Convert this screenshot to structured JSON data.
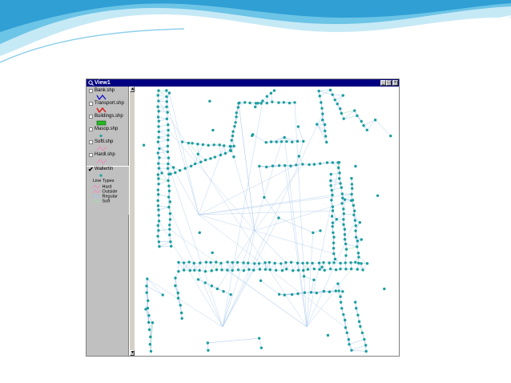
{
  "window": {
    "title": "View1",
    "minimize": "_",
    "maximize": "□",
    "close": "×"
  },
  "toc": {
    "layers": [
      {
        "name": "Bank.shp",
        "checked": false,
        "symbol": "blue-line-icon",
        "color": "#1a1acc"
      },
      {
        "name": "Transport.shp",
        "checked": false,
        "symbol": "red-line-icon",
        "color": "#dd1111"
      },
      {
        "name": "Buildings.shp",
        "checked": false,
        "symbol": "green-fill-icon",
        "color": "#22bb22"
      },
      {
        "name": "Masop.shp",
        "checked": false,
        "symbol": "teal-point-icon",
        "color": "#1aa3a3"
      },
      {
        "name": "Softl.shp",
        "checked": false,
        "symbol": "pink-line-icon",
        "color": "#ee88bb"
      },
      {
        "name": "Hardl.shp",
        "checked": false,
        "symbol": "pink-line-icon",
        "color": "#ee88bb"
      },
      {
        "name": "Wallertin",
        "checked": true,
        "symbol": "teal-point-icon",
        "color": "#1aa3a3"
      }
    ],
    "legend_title": "Line Types",
    "legend": [
      {
        "label": "Hard",
        "color": "#ee88bb"
      },
      {
        "label": "Outside",
        "color": "#ee88bb"
      },
      {
        "label": "Regular",
        "color": "#9ec8f0"
      },
      {
        "label": "Soft",
        "color": "#9ee0a8"
      }
    ]
  },
  "map": {
    "edge_color": "#a8c8ec",
    "soft_color": "#9ee0a8",
    "point_color": "#1a9e9e"
  },
  "theme": {
    "wave_dark": "#3aa9d8",
    "wave_light": "#a9ddf2",
    "titlebar": "#000080"
  }
}
